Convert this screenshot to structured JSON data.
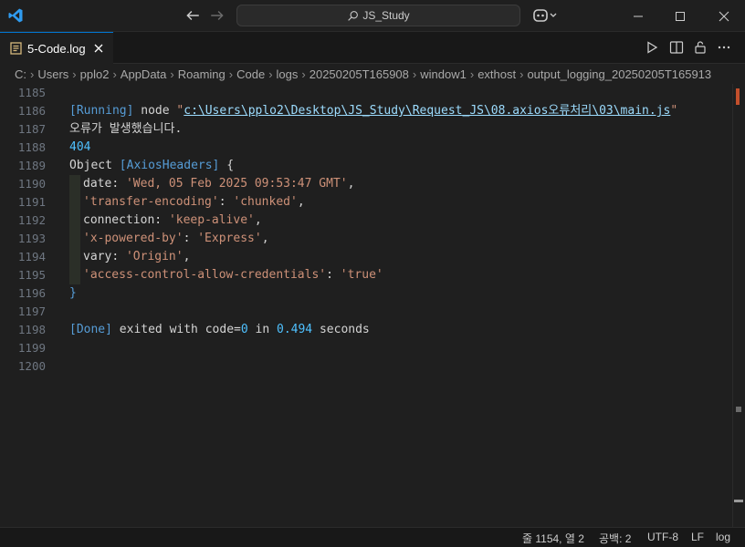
{
  "titlebar": {
    "search_text": "JS_Study"
  },
  "tab": {
    "label": "5-Code.log"
  },
  "breadcrumb": [
    "C:",
    "Users",
    "pplo2",
    "AppData",
    "Roaming",
    "Code",
    "logs",
    "20250205T165908",
    "window1",
    "exthost",
    "output_logging_20250205T165913"
  ],
  "editor": {
    "lines": [
      {
        "n": "1185"
      },
      {
        "n": "1186"
      },
      {
        "n": "1187"
      },
      {
        "n": "1188"
      },
      {
        "n": "1189"
      },
      {
        "n": "1190"
      },
      {
        "n": "1191"
      },
      {
        "n": "1192"
      },
      {
        "n": "1193"
      },
      {
        "n": "1194"
      },
      {
        "n": "1195"
      },
      {
        "n": "1196"
      },
      {
        "n": "1197"
      },
      {
        "n": "1198"
      },
      {
        "n": "1199"
      },
      {
        "n": "1200"
      }
    ],
    "running_label": "[Running]",
    "node_cmd": " node ",
    "quote": "\"",
    "path": "c:\\Users\\pplo2\\Desktop\\JS_Study\\Request_JS\\08.axios오류처리\\03\\main.js",
    "error_msg": "오류가 발생했습니다.",
    "status_code": "404",
    "object_head_1": "Object ",
    "object_head_2": "[AxiosHeaders]",
    "object_head_3": " {",
    "headers": [
      {
        "key": "date",
        "quoted": false,
        "value": "'Wed, 05 Feb 2025 09:53:47 GMT'"
      },
      {
        "key": "'transfer-encoding'",
        "quoted": true,
        "value": "'chunked'"
      },
      {
        "key": "connection",
        "quoted": false,
        "value": "'keep-alive'"
      },
      {
        "key": "'x-powered-by'",
        "quoted": true,
        "value": "'Express'"
      },
      {
        "key": "vary",
        "quoted": false,
        "value": "'Origin'"
      },
      {
        "key": "'access-control-allow-credentials'",
        "quoted": true,
        "value": "'true'"
      }
    ],
    "close_brace": "}",
    "done_label": "[Done]",
    "done_text_1": " exited with code=",
    "done_code": "0",
    "done_text_2": " in ",
    "done_seconds": "0.494",
    "done_text_3": " seconds"
  },
  "status": {
    "position": "줄 1154, 열 2",
    "spaces": "공백: 2",
    "encoding": "UTF-8",
    "eol": "LF",
    "language": "log"
  },
  "colors": {
    "accent": "#0078d4",
    "background": "#1f1f1f",
    "scroll_marker": "#c34f2c"
  }
}
